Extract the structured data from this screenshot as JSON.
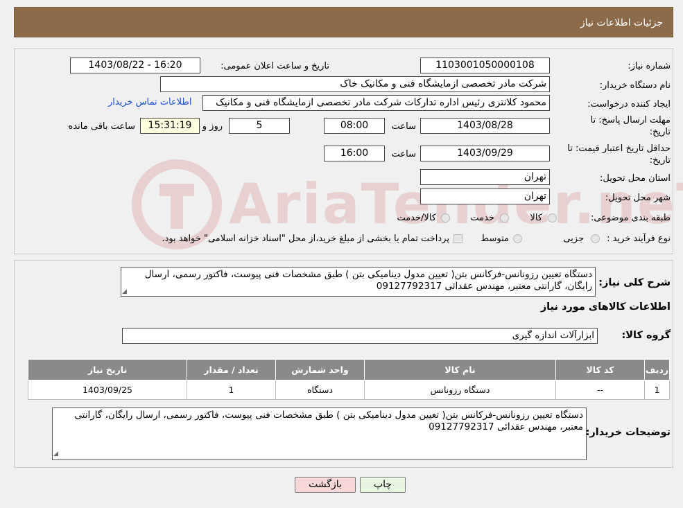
{
  "header": {
    "title": "جزئیات اطلاعات نیاز"
  },
  "form": {
    "need_number_label": "شماره نیاز:",
    "need_number": "1103001050000108",
    "announce_label": "تاریخ و ساعت اعلان عمومی:",
    "announce_value": "1403/08/22 - 16:20",
    "buyer_org_label": "نام دستگاه خریدار:",
    "buyer_org": "شرکت مادر تخصصی ازمایشگاه فنی و مکانیک خاک",
    "creator_label": "ایجاد کننده درخواست:",
    "creator": "محمود کلانتری رئیس اداره تدارکات شرکت مادر تخصصی ازمایشگاه فنی و مکانیک",
    "contact_link": "اطلاعات تماس خریدار",
    "deadline_label_1": "مهلت ارسال پاسخ: تا",
    "deadline_label_2": "تاریخ:",
    "deadline_date": "1403/08/28",
    "time_label": "ساعت",
    "deadline_time": "08:00",
    "days_value": "5",
    "days_label": "روز و",
    "remaining_time": "15:31:19",
    "remaining_label": "ساعت باقی مانده",
    "validity_label_1": "حداقل تاریخ اعتبار قیمت: تا",
    "validity_label_2": "تاریخ:",
    "validity_date": "1403/09/29",
    "validity_time": "16:00",
    "province_label": "استان محل تحویل:",
    "province": "تهران",
    "city_label": "شهر محل تحویل:",
    "city": "تهران",
    "category_label": "طبقه بندی موضوعی:",
    "category_options": [
      "کالا",
      "خدمت",
      "کالا/خدمت"
    ],
    "process_label": "نوع فرآیند خرید :",
    "process_options": [
      "جزیی",
      "متوسط"
    ],
    "process_note": "پرداخت تمام یا بخشی از مبلغ خرید،از محل \"اسناد خزانه اسلامی\" خواهد بود."
  },
  "details": {
    "summary_label": "شرح کلی نیاز:",
    "summary": "دستگاه تعیین رزونانس-فرکانس بتن( تعیین مدول دینامیکی بتن ) طبق مشخصات فنی پیوست، فاکتور رسمی، ارسال رایگان، گارانتی معتبر، مهندس عقدائی 09127792317",
    "items_heading": "اطلاعات کالاهای مورد نیاز",
    "group_label": "گروه کالا:",
    "group_value": "ابزارآلات اندازه گیری",
    "table_headers": [
      "ردیف",
      "کد کالا",
      "نام کالا",
      "واحد شمارش",
      "تعداد / مقدار",
      "تاریخ نیاز"
    ],
    "table_rows": [
      [
        "1",
        "--",
        "دستگاه رزونانس",
        "دستگاه",
        "1",
        "1403/09/25"
      ]
    ],
    "buyer_notes_label": "توضیحات خریدار:",
    "buyer_notes": "دستگاه تعیین رزونانس-فرکانس بتن( تعیین مدول دینامیکی بتن ) طبق مشخصات فنی پیوست، فاکتور رسمی، ارسال رایگان، گارانتی معتبر، مهندس عقدائی 09127792317"
  },
  "buttons": {
    "print": "چاپ",
    "back": "بازگشت"
  },
  "watermark_text": "AriaTender.neT",
  "colors": {
    "header_bg": "#8b6b4a",
    "table_header_bg": "#8a8a8a",
    "back_button_bg": "#f7d7d7",
    "print_button_bg": "#e8f5e0",
    "link": "#1a4ed8"
  }
}
